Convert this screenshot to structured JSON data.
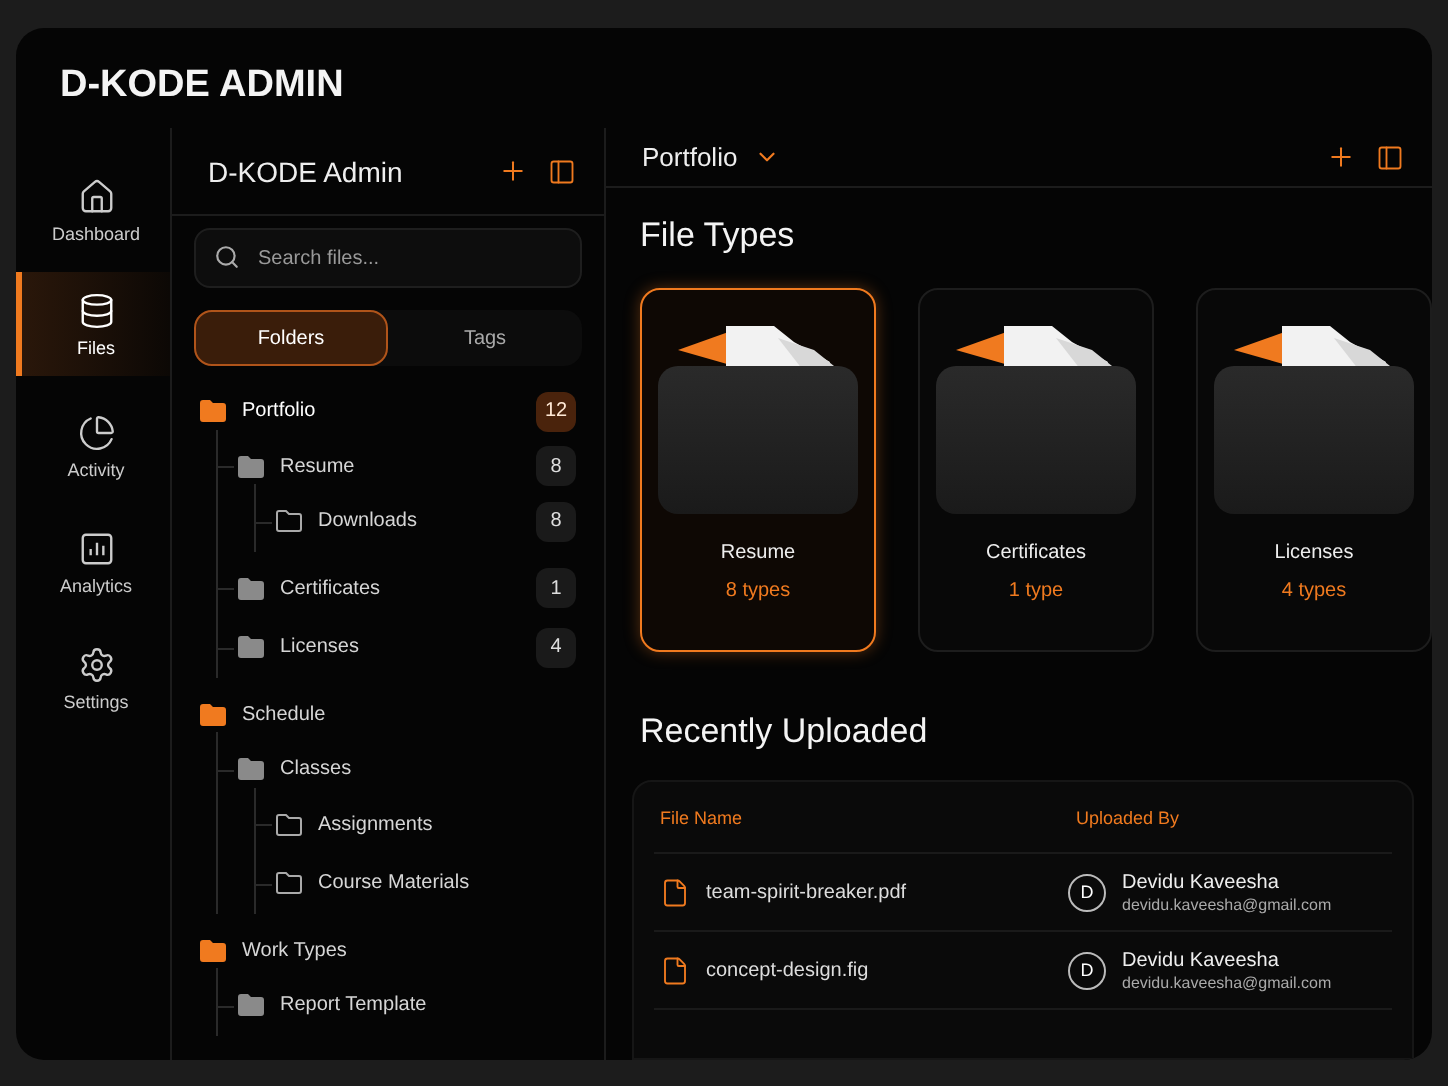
{
  "app": {
    "title": "D-KODE ADMIN"
  },
  "nav": [
    {
      "label": "Dashboard",
      "kind": "home",
      "selected": false
    },
    {
      "label": "Files",
      "kind": "database",
      "selected": true
    },
    {
      "label": "Activity",
      "kind": "pie",
      "selected": false
    },
    {
      "label": "Analytics",
      "kind": "bars",
      "selected": false
    },
    {
      "label": "Settings",
      "kind": "gear",
      "selected": false
    }
  ],
  "explorer": {
    "title": "D-KODE Admin",
    "search": {
      "placeholder": "Search files..."
    },
    "tabs": [
      {
        "label": "Folders",
        "selected": true
      },
      {
        "label": "Tags",
        "selected": false
      }
    ],
    "tree": [
      {
        "name": "Portfolio",
        "count": "12",
        "selected": true,
        "children": [
          {
            "name": "Resume",
            "count": "8",
            "selected": false,
            "children": [
              {
                "name": "Downloads",
                "count": "8",
                "selected": false
              }
            ]
          },
          {
            "name": "Certificates",
            "count": "1",
            "selected": false
          },
          {
            "name": "Licenses",
            "count": "4",
            "selected": false
          }
        ]
      },
      {
        "name": "Schedule",
        "selected": false,
        "children": [
          {
            "name": "Classes",
            "selected": false,
            "children": [
              {
                "name": "Assignments",
                "selected": false
              },
              {
                "name": "Course Materials",
                "selected": false
              }
            ]
          }
        ]
      },
      {
        "name": "Work Types",
        "selected": false,
        "children": [
          {
            "name": "Report Template",
            "selected": false
          }
        ]
      }
    ]
  },
  "main": {
    "breadcrumb": "Portfolio",
    "file_types": {
      "title": "File Types",
      "cards": [
        {
          "name": "Resume",
          "count": "8 types",
          "selected": true
        },
        {
          "name": "Certificates",
          "count": "1 type",
          "selected": false
        },
        {
          "name": "Licenses",
          "count": "4 types",
          "selected": false
        }
      ]
    },
    "recent": {
      "title": "Recently Uploaded",
      "columns": [
        "File Name",
        "Uploaded By"
      ],
      "rows": [
        {
          "file": "team-spirit-breaker.pdf",
          "avatar": "D",
          "user": "Devidu Kaveesha",
          "email": "devidu.kaveesha@gmail.com"
        },
        {
          "file": "concept-design.fig",
          "avatar": "D",
          "user": "Devidu Kaveesha",
          "email": "devidu.kaveesha@gmail.com"
        }
      ]
    }
  }
}
